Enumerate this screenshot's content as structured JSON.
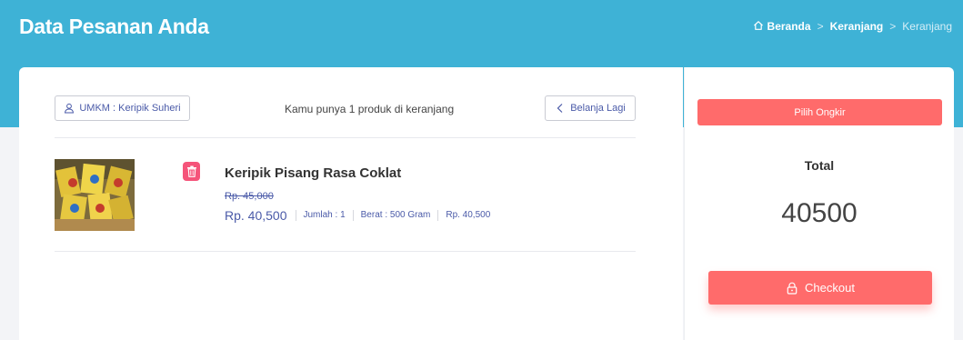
{
  "header": {
    "title": "Data Pesanan Anda",
    "breadcrumb": [
      {
        "label": "Beranda",
        "icon": "home-icon"
      },
      {
        "label": "Keranjang"
      },
      {
        "label": "Keranjang"
      }
    ]
  },
  "cart": {
    "umkm_label": "UMKM : Keripik Suheri",
    "summary": "Kamu punya 1 produk di keranjang",
    "back_label": "Belanja Lagi",
    "items": [
      {
        "name": "Keripik Pisang Rasa Coklat",
        "price_old": "Rp. 45,000",
        "price_now": "Rp. 40,500",
        "quantity": "Jumlah : 1",
        "weight": "Berat : 500 Gram",
        "subtotal": "Rp. 40,500"
      }
    ]
  },
  "sidebar": {
    "ongkir_label": "Pilih Ongkir",
    "total_label": "Total",
    "total_value": "40500",
    "checkout_label": "Checkout"
  },
  "colors": {
    "header": "#3eb2d6",
    "accent": "#ff6b6b",
    "delete": "#f5547a",
    "link": "#4a5aa8"
  }
}
